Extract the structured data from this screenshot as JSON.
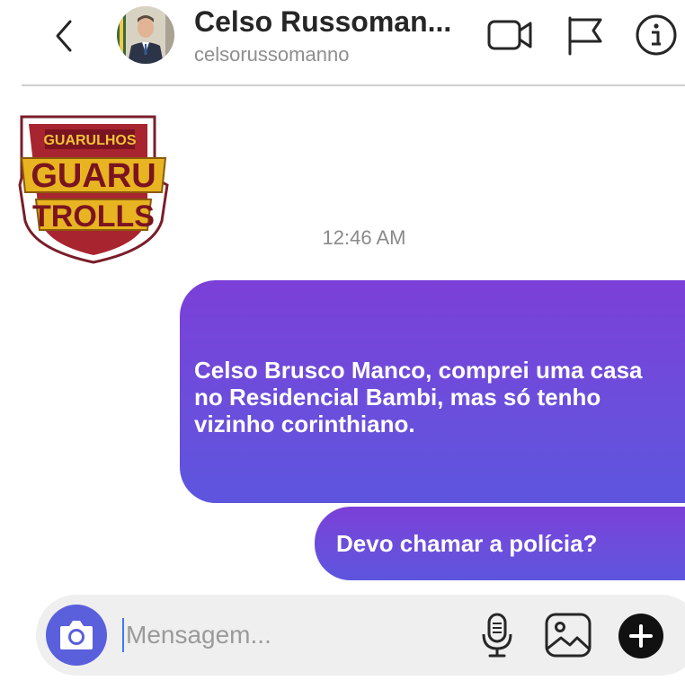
{
  "header": {
    "contact_name": "Celso Russoman...",
    "contact_handle": "celsorussomanno"
  },
  "sender_avatar": {
    "logo_text_top": "GUARULHOS",
    "logo_text_middle": "GUARU",
    "logo_text_bottom": "TROLLS"
  },
  "thread": {
    "timestamp": "12:46 AM",
    "messages": [
      {
        "text": "Celso Brusco Manco, comprei uma casa no Residencial Bambi, mas só tenho vizinho corinthiano."
      },
      {
        "text": "Devo chamar a polícia?"
      }
    ]
  },
  "composer": {
    "placeholder": "Mensagem...",
    "value": ""
  },
  "colors": {
    "bubble_top": "#7b3fd8",
    "bubble_bottom": "#5d55de",
    "camera_button": "#5a5fdc"
  },
  "icons": [
    "back-icon",
    "video-call-icon",
    "flag-icon",
    "info-icon",
    "camera-icon",
    "microphone-icon",
    "gallery-icon",
    "plus-icon"
  ]
}
